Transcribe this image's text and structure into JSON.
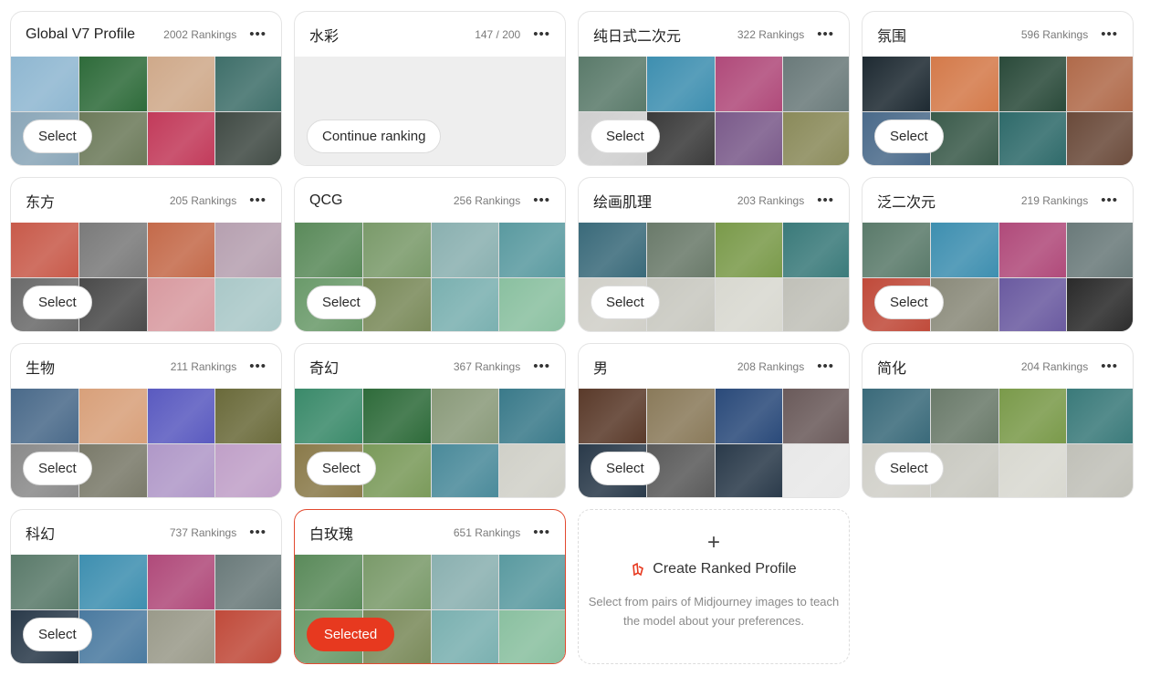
{
  "select_label": "Select",
  "profiles": [
    {
      "title": "Global V7 Profile",
      "count": "2002 Rankings",
      "button": "Select",
      "state": "select",
      "colors": [
        "#8fb7d1",
        "#2e6b3a",
        "#cfa98a",
        "#3f6f6a",
        "#8aa6b8",
        "#6c7a5a",
        "#c23a5a",
        "#404a44"
      ]
    },
    {
      "title": "水彩",
      "count": "147 / 200",
      "button": "Continue ranking",
      "state": "continue",
      "colors": []
    },
    {
      "title": "纯日式二次元",
      "count": "322 Rankings",
      "button": "Select",
      "state": "select",
      "colors": [
        "#5a7a6a",
        "#3e8fb0",
        "#b04a7a",
        "#6a7a7a",
        "#cfcfcf",
        "#3a3a3a",
        "#7a5a8a",
        "#8a8a5a"
      ]
    },
    {
      "title": "氛围",
      "count": "596 Rankings",
      "button": "Select",
      "state": "select",
      "colors": [
        "#1e2a32",
        "#d47a4a",
        "#2a4a3a",
        "#b06a4a",
        "#4a6a8a",
        "#3a5a4a",
        "#2e6a6a",
        "#6a4a3a"
      ]
    },
    {
      "title": "东方",
      "count": "205 Rankings",
      "button": "Select",
      "state": "select",
      "colors": [
        "#c85a4a",
        "#7a7a7a",
        "#c46a4a",
        "#b6a0b0",
        "#6a6a6a",
        "#4a4a4a",
        "#d89aa0",
        "#aac8c8"
      ]
    },
    {
      "title": "QCG",
      "count": "256 Rankings",
      "button": "Select",
      "state": "select",
      "colors": [
        "#5a8a5a",
        "#7a9a6a",
        "#8ab0b0",
        "#5a9aa0",
        "#6a9a6a",
        "#7a8a5a",
        "#7ab0b0",
        "#8ac0a0"
      ]
    },
    {
      "title": "绘画肌理",
      "count": "203 Rankings",
      "button": "Select",
      "state": "select",
      "colors": [
        "#3a6a7a",
        "#6a7a6a",
        "#7a9a4a",
        "#3a7a7a",
        "#d0cfc8",
        "#c8c8c0",
        "#d8d8d0",
        "#c0c0b8"
      ]
    },
    {
      "title": "泛二次元",
      "count": "219 Rankings",
      "button": "Select",
      "state": "select",
      "colors": [
        "#5a7a6a",
        "#3e8fb0",
        "#b04a7a",
        "#6a7a7a",
        "#c04a3a",
        "#8a8a7a",
        "#6a5aa0",
        "#2a2a2a"
      ]
    },
    {
      "title": "生物",
      "count": "211 Rankings",
      "button": "Select",
      "state": "select",
      "colors": [
        "#4a6a8a",
        "#d8a07a",
        "#5a5ac0",
        "#6a6a3a",
        "#8a8a8a",
        "#7a7a6a",
        "#b098c8",
        "#c0a0c8"
      ]
    },
    {
      "title": "奇幻",
      "count": "367 Rankings",
      "button": "Select",
      "state": "select",
      "colors": [
        "#3a8a6a",
        "#2e6b3a",
        "#8a9a7a",
        "#3a7a8a",
        "#8a7a4a",
        "#7a9a5a",
        "#4a8a9a",
        "#d0d0c8"
      ]
    },
    {
      "title": "男",
      "count": "208 Rankings",
      "button": "Select",
      "state": "select",
      "colors": [
        "#5a3a2a",
        "#8a7a5a",
        "#2a4a7a",
        "#6a5a5a",
        "#2a3a4a",
        "#5a5a5a",
        "#2a3a4a",
        "#e8e8e8"
      ]
    },
    {
      "title": "简化",
      "count": "204 Rankings",
      "button": "Select",
      "state": "select",
      "colors": [
        "#3a6a7a",
        "#6a7a6a",
        "#7a9a4a",
        "#3a7a7a",
        "#d0cfc8",
        "#c8c8c0",
        "#d8d8d0",
        "#c0c0b8"
      ]
    },
    {
      "title": "科幻",
      "count": "737 Rankings",
      "button": "Select",
      "state": "select",
      "colors": [
        "#5a7a6a",
        "#3e8fb0",
        "#b04a7a",
        "#6a7a7a",
        "#2a3a4a",
        "#4a7aa0",
        "#9a9a8a",
        "#c04a3a"
      ]
    },
    {
      "title": "白玫瑰",
      "count": "651 Rankings",
      "button": "Selected",
      "state": "selected",
      "colors": [
        "#5a8a5a",
        "#7a9a6a",
        "#8ab0b0",
        "#5a9aa0",
        "#6a9a6a",
        "#7a8a5a",
        "#7ab0b0",
        "#8ac0a0"
      ]
    }
  ],
  "create": {
    "plus": "+",
    "title": "Create Ranked Profile",
    "description": "Select from pairs of Midjourney images to teach the model about your preferences.",
    "accent": "#e7391f"
  },
  "more_glyph": "•••",
  "accent": "#e7391f"
}
